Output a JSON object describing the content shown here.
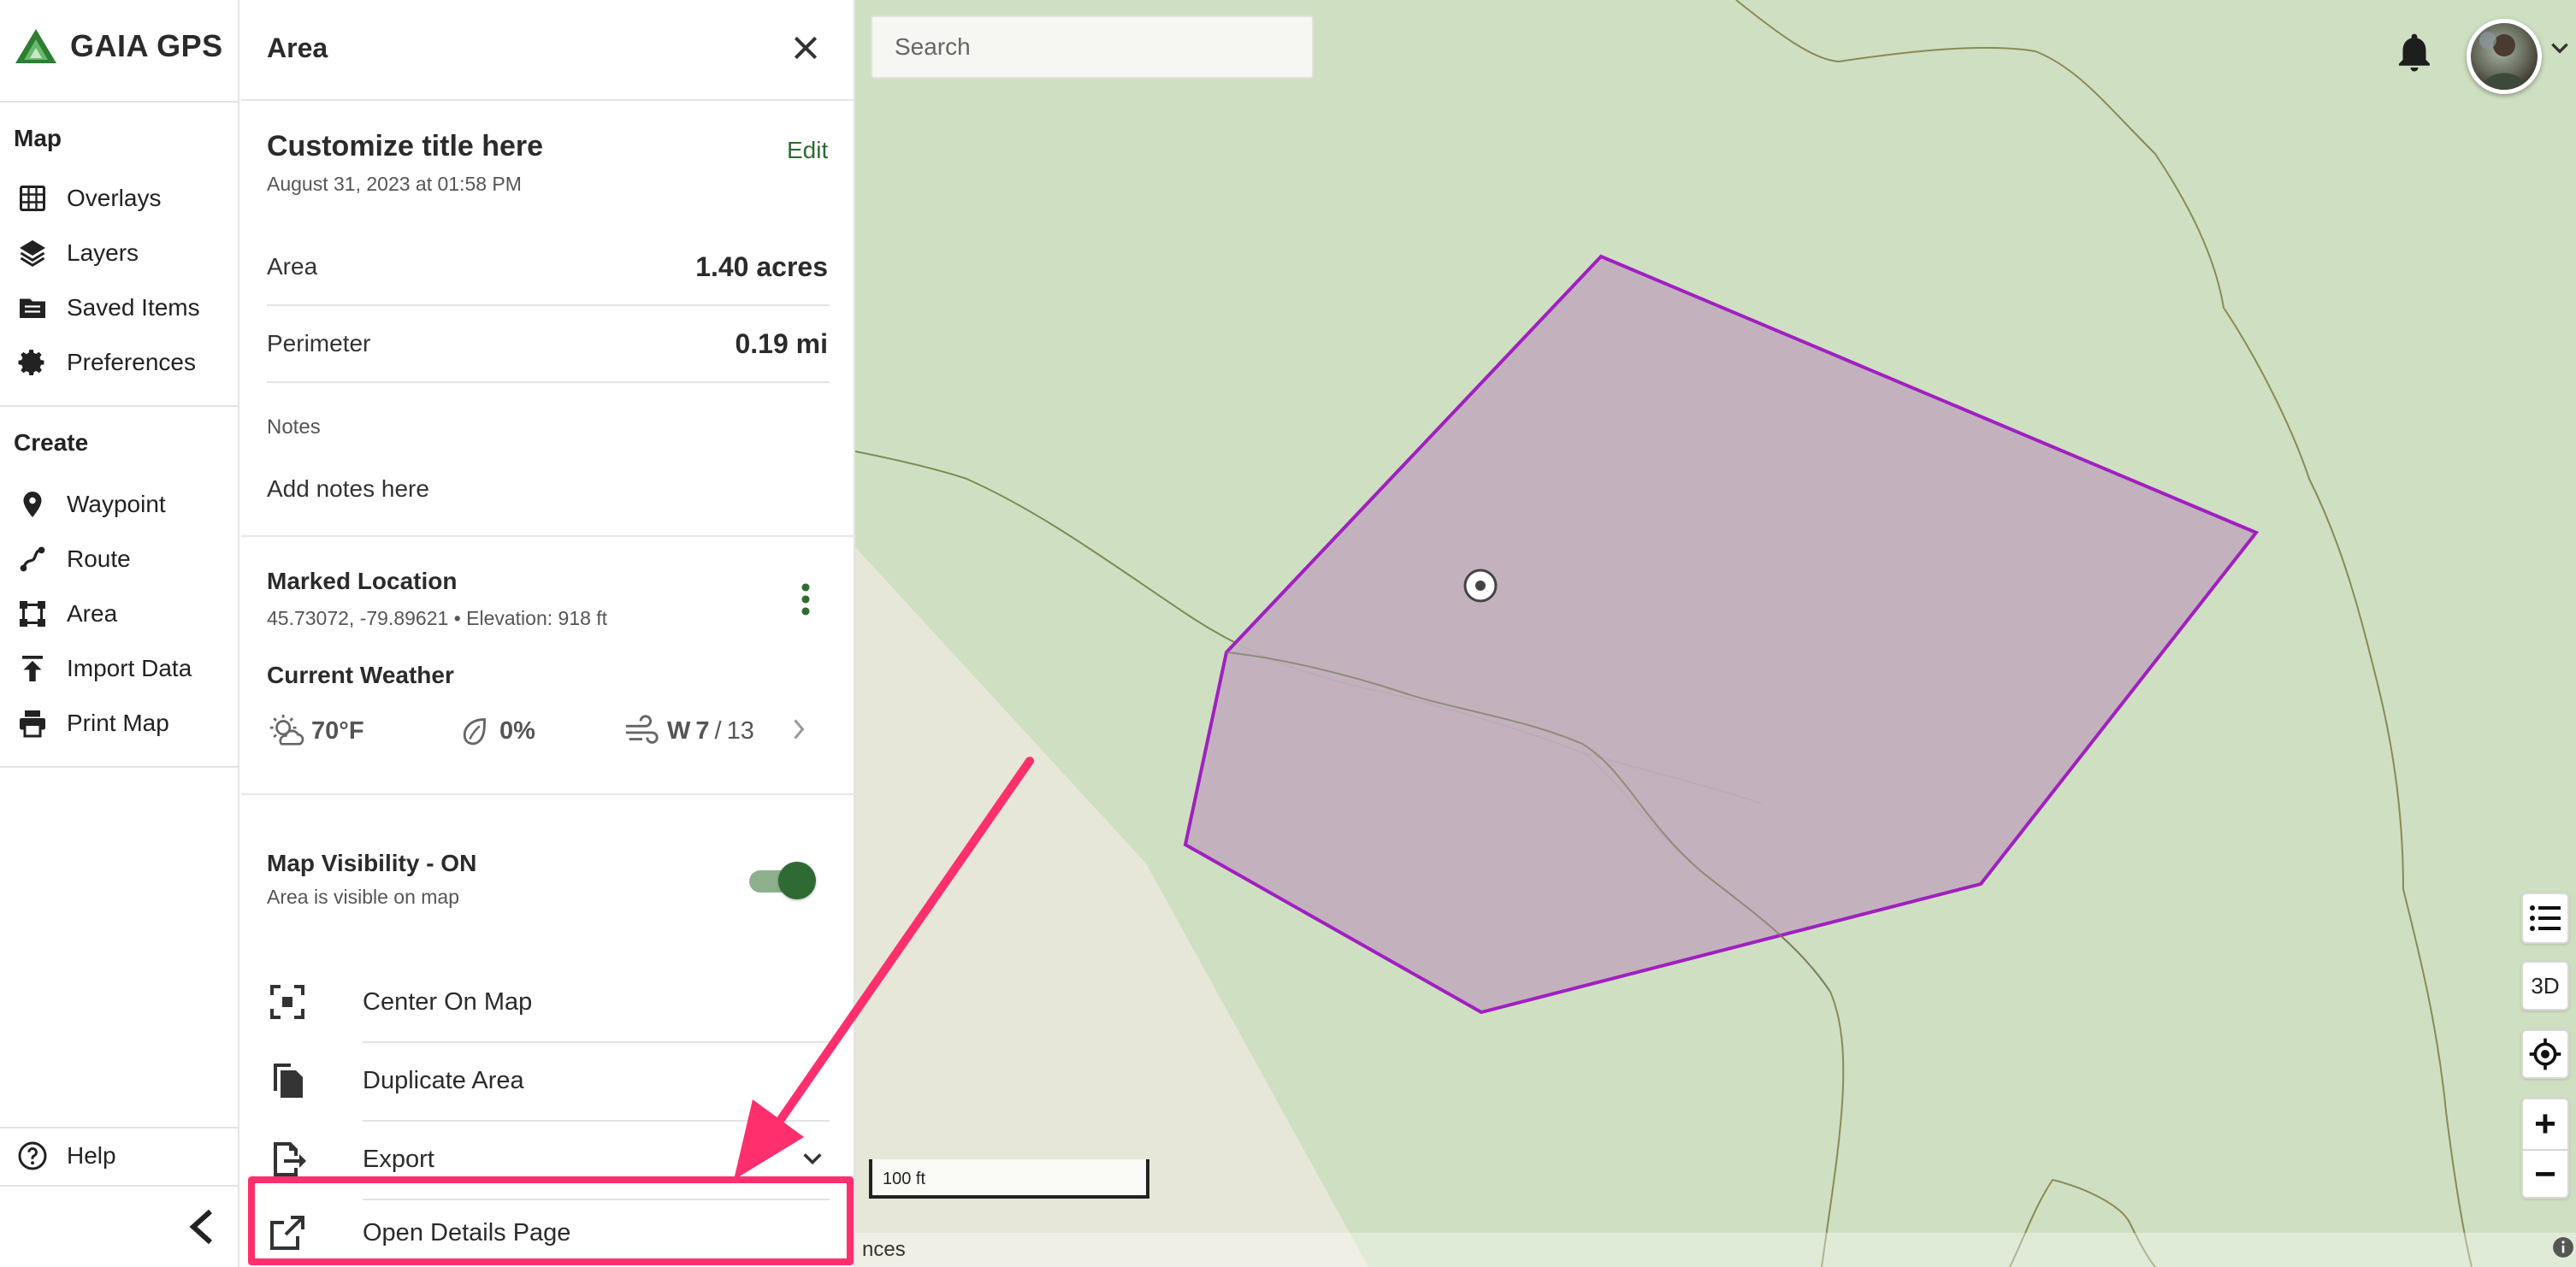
{
  "brand": {
    "name": "GAIA GPS"
  },
  "nav": {
    "map_heading": "Map",
    "map_items": [
      {
        "label": "Overlays",
        "icon": "overlays-icon"
      },
      {
        "label": "Layers",
        "icon": "layers-icon"
      },
      {
        "label": "Saved Items",
        "icon": "folder-icon"
      },
      {
        "label": "Preferences",
        "icon": "gear-icon"
      }
    ],
    "create_heading": "Create",
    "create_items": [
      {
        "label": "Waypoint",
        "icon": "pin-icon"
      },
      {
        "label": "Route",
        "icon": "route-icon"
      },
      {
        "label": "Area",
        "icon": "area-icon"
      },
      {
        "label": "Import Data",
        "icon": "upload-icon"
      },
      {
        "label": "Print Map",
        "icon": "print-icon"
      }
    ],
    "help_label": "Help"
  },
  "panel": {
    "title": "Area",
    "custom_title": "Customize title here",
    "edit_label": "Edit",
    "date": "August 31, 2023 at 01:58 PM",
    "stats": [
      {
        "label": "Area",
        "value": "1.40 acres"
      },
      {
        "label": "Perimeter",
        "value": "0.19 mi"
      }
    ],
    "notes_label": "Notes",
    "notes_placeholder": "Add notes here",
    "marked_location": {
      "title": "Marked Location",
      "coords": "45.73072, -79.89621 • Elevation: 918 ft"
    },
    "weather": {
      "title": "Current Weather",
      "temp": "70°F",
      "precip": "0%",
      "wind_dir": "W",
      "wind_speed": "7",
      "wind_sep": "/",
      "wind_gust": "13"
    },
    "visibility": {
      "title": "Map Visibility - ON",
      "subtitle": "Area is visible on map",
      "on": true
    },
    "actions": [
      {
        "label": "Center On Map",
        "icon": "center-icon"
      },
      {
        "label": "Duplicate Area",
        "icon": "duplicate-icon"
      },
      {
        "label": "Export",
        "icon": "export-icon"
      },
      {
        "label": "Open Details Page",
        "icon": "open-external-icon"
      }
    ]
  },
  "map": {
    "search_placeholder": "Search",
    "view_3d_label": "3D",
    "zoom_in_label": "+",
    "zoom_out_label": "−",
    "scale_label": "100 ft",
    "attribution_fragment": "nces",
    "area_stroke_color": "#a020c0",
    "area_fill_color": "#c2aebe",
    "highlight_color": "#ff2f6e"
  }
}
